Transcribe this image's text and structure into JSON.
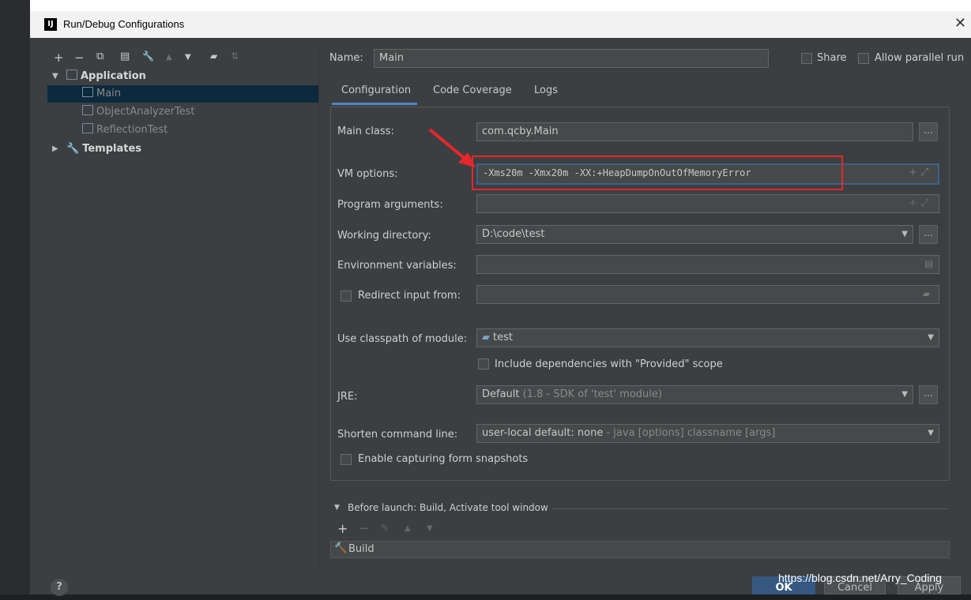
{
  "window": {
    "title": "Run/Debug Configurations",
    "logo": "IJ"
  },
  "toolbar": {
    "icons": [
      "add-icon",
      "remove-icon",
      "copy-icon",
      "save-icon",
      "wrench-icon",
      "up-arrow-icon",
      "down-arrow-icon",
      "folder-icon",
      "sort-icon"
    ],
    "glyphs": {
      "add": "+",
      "remove": "−",
      "copy": "⧉",
      "save": "▤",
      "wrench": "🔧",
      "up": "▲",
      "down": "▼",
      "folder": "▰",
      "sort": "⇅"
    }
  },
  "tree": {
    "application": "Application",
    "items": [
      "Main",
      "ObjectAnalyzerTest",
      "ReflectionTest"
    ],
    "templates": "Templates"
  },
  "name": {
    "label": "Name:",
    "value": "Main"
  },
  "share": {
    "label": "Share"
  },
  "parallel": {
    "label": "Allow parallel run"
  },
  "tabs": [
    "Configuration",
    "Code Coverage",
    "Logs"
  ],
  "config": {
    "main_class": {
      "label": "Main class:",
      "value": "com.qcby.Main"
    },
    "vm_options": {
      "label": "VM options:",
      "value": "-Xms20m -Xmx20m -XX:+HeapDumpOnOutOfMemoryError"
    },
    "program_args": {
      "label": "Program arguments:",
      "value": ""
    },
    "working_dir": {
      "label": "Working directory:",
      "value": "D:\\code\\test"
    },
    "env_vars": {
      "label": "Environment variables:",
      "value": ""
    },
    "redirect": {
      "label": "Redirect input from:",
      "value": ""
    },
    "classpath": {
      "label": "Use classpath of module:",
      "value": "test"
    },
    "include_deps": {
      "label": "Include dependencies with \"Provided\" scope"
    },
    "jre": {
      "label": "JRE:",
      "value_main": "Default",
      "value_hint": "(1.8 - SDK of 'test' module)"
    },
    "shorten": {
      "label": "Shorten command line:",
      "value_main": "user-local default: none",
      "value_hint": "- java [options] classname [args]"
    },
    "snapshots": {
      "label": "Enable capturing form snapshots"
    }
  },
  "before_launch": {
    "label": "Before launch: Build, Activate tool window",
    "item": "Build"
  },
  "buttons": {
    "ok": "OK",
    "cancel": "Cancel",
    "apply": "Apply",
    "help": "?"
  },
  "watermark": "https://blog.csdn.net/Arry_Coding",
  "colors": {
    "accent": "#4a88c7",
    "highlight": "#e8262b",
    "selection": "#0d293e"
  }
}
